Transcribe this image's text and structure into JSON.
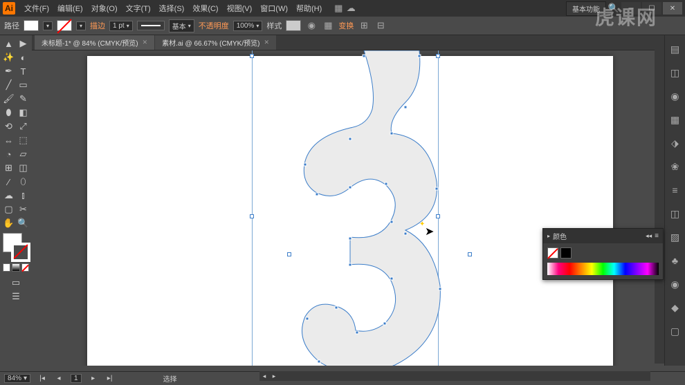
{
  "app": {
    "icon_text": "Ai"
  },
  "menu": {
    "items": [
      "文件(F)",
      "编辑(E)",
      "对象(O)",
      "文字(T)",
      "选择(S)",
      "效果(C)",
      "视图(V)",
      "窗口(W)",
      "帮助(H)"
    ]
  },
  "workspace": {
    "label": "基本功能"
  },
  "control": {
    "path_label": "路径",
    "stroke_text": "描边",
    "stroke_pt": "1 pt",
    "stroke_style": "基本",
    "opacity_label": "不透明度",
    "opacity_val": "100%",
    "style_label": "样式",
    "transform_label": "变换"
  },
  "tabs": [
    {
      "label": "未标题-1* @ 84% (CMYK/预览)",
      "active": true
    },
    {
      "label": "素材.ai @ 66.67% (CMYK/预览)",
      "active": false
    }
  ],
  "status": {
    "zoom": "84%",
    "page": "1",
    "tool": "选择"
  },
  "panels": {
    "color_title": "颜色"
  },
  "watermark": "虎课网"
}
